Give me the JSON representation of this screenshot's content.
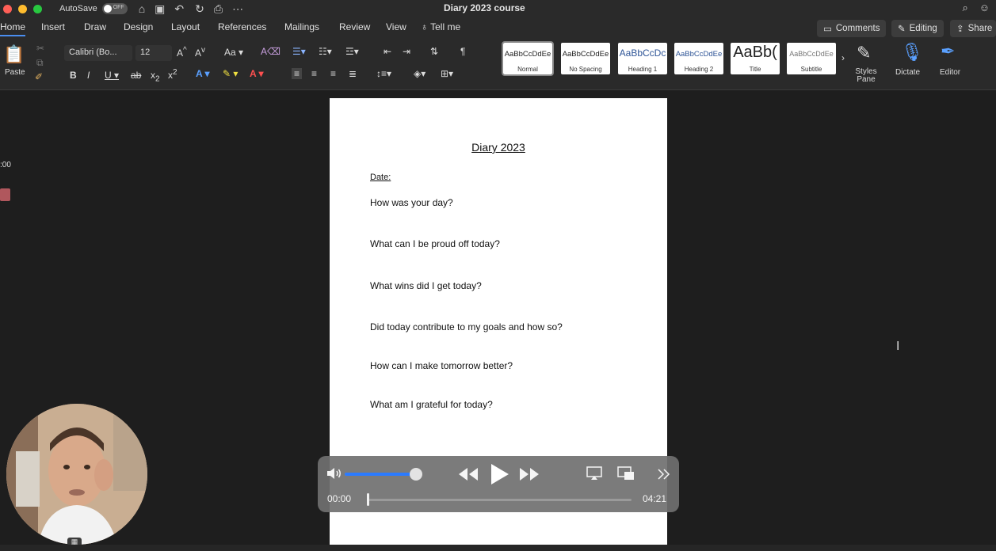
{
  "titlebar": {
    "autosave_label": "AutoSave",
    "toggle_state": "OFF",
    "document_title": "Diary 2023 course"
  },
  "menu": {
    "tabs": [
      "Home",
      "Insert",
      "Draw",
      "Design",
      "Layout",
      "References",
      "Mailings",
      "Review",
      "View",
      "Tell me"
    ],
    "comments_label": "Comments",
    "editing_label": "Editing",
    "share_label": "Share"
  },
  "ribbon": {
    "paste_label": "Paste",
    "font_name": "Calibri (Bo...",
    "font_size": "12",
    "styles": [
      {
        "preview": "AaBbCcDdEe",
        "name": "Normal"
      },
      {
        "preview": "AaBbCcDdEe",
        "name": "No Spacing"
      },
      {
        "preview": "AaBbCcDc",
        "name": "Heading 1"
      },
      {
        "preview": "AaBbCcDdEe",
        "name": "Heading 2"
      },
      {
        "preview": "AaBb(",
        "name": "Title"
      },
      {
        "preview": "AaBbCcDdEe",
        "name": "Subtitle"
      }
    ],
    "styles_pane_label": "Styles Pane",
    "dictate_label": "Dictate",
    "editor_label": "Editor"
  },
  "document": {
    "heading": "Diary 2023",
    "date_label": "Date:",
    "questions": [
      "How was your day?",
      "What can I be proud off today?",
      "What wins did I get today?",
      "Did today contribute to my goals and how so?",
      "How can I make tomorrow better?",
      "What am I grateful for today?"
    ]
  },
  "left_panel": {
    "time_fragment": ":00"
  },
  "player": {
    "current_time": "00:00",
    "total_time": "04:21",
    "volume_fraction": 0.94,
    "progress_fraction": 0.0
  }
}
